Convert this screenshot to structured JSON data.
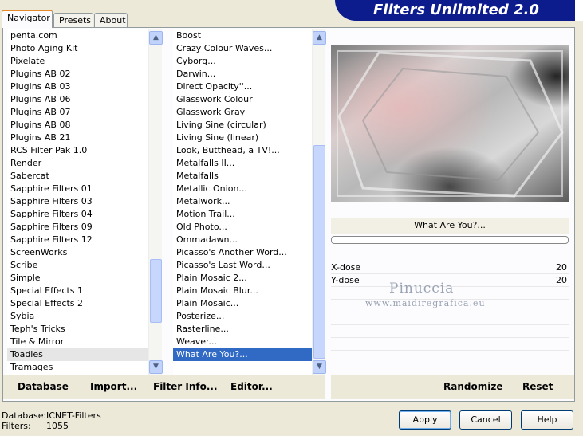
{
  "tabs": [
    {
      "label": "Navigator",
      "active": true
    },
    {
      "label": "Presets",
      "active": false
    },
    {
      "label": "About",
      "active": false
    }
  ],
  "banner_title": "Filters Unlimited 2.0",
  "categories": [
    "penta.com",
    "Photo Aging Kit",
    "Pixelate",
    "Plugins AB 02",
    "Plugins AB 03",
    "Plugins AB 06",
    "Plugins AB 07",
    "Plugins AB 08",
    "Plugins AB 21",
    "RCS Filter Pak 1.0",
    "Render",
    "Sabercat",
    "Sapphire Filters 01",
    "Sapphire Filters 03",
    "Sapphire Filters 04",
    "Sapphire Filters 09",
    "Sapphire Filters 12",
    "ScreenWorks",
    "Scribe",
    "Simple",
    "Special Effects 1",
    "Special Effects 2",
    "Sybia",
    "Teph's Tricks",
    "Tile & Mirror",
    "Toadies",
    "Tramages"
  ],
  "selected_category": "Toadies",
  "filters": [
    "Boost",
    "Crazy Colour Waves...",
    "Cyborg...",
    "Darwin...",
    "Direct Opacity''...",
    "Glasswork Colour",
    "Glasswork Gray",
    "Living Sine (circular)",
    "Living Sine (linear)",
    "Look, Butthead, a TV!...",
    "Metalfalls II...",
    "Metalfalls",
    "Metallic Onion...",
    "Metalwork...",
    "Motion Trail...",
    "Old Photo...",
    "Ommadawn...",
    "Picasso's Another Word...",
    "Picasso's Last Word...",
    "Plain Mosaic 2...",
    "Plain Mosaic Blur...",
    "Plain Mosaic...",
    "Posterize...",
    "Rasterline...",
    "Weaver...",
    "What Are You?..."
  ],
  "selected_filter": "What Are You?...",
  "current_effect": "What Are You?...",
  "progress": 0,
  "params": [
    {
      "label": "X-dose",
      "value": "20"
    },
    {
      "label": "Y-dose",
      "value": "20"
    }
  ],
  "watermark": {
    "name": "Pinuccia",
    "url": "www.maidiregrafica.eu"
  },
  "toolbar": {
    "database": "Database",
    "import": "Import...",
    "filter_info": "Filter Info...",
    "editor": "Editor...",
    "randomize": "Randomize",
    "reset": "Reset"
  },
  "status": {
    "database_label": "Database:",
    "database_value": "ICNET-Filters",
    "filters_label": "Filters:",
    "filters_value": "1055"
  },
  "buttons": {
    "apply": "Apply",
    "cancel": "Cancel",
    "help": "Help"
  }
}
